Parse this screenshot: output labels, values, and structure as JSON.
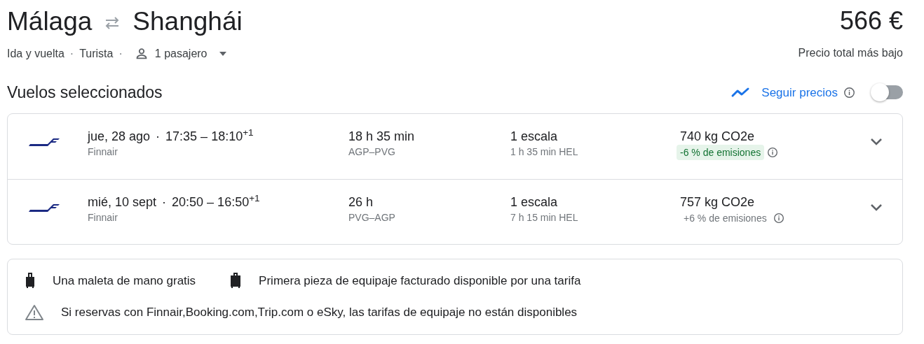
{
  "route": {
    "origin": "Málaga",
    "destination": "Shanghái"
  },
  "trip": {
    "type": "Ida y vuelta",
    "separator_1": "·",
    "cabin": "Turista",
    "separator_2": "·",
    "passengers": "1 pasajero"
  },
  "price": {
    "amount": "566 €",
    "caption": "Precio total más bajo"
  },
  "section_title": "Vuelos seleccionados",
  "track_prices": {
    "label": "Seguir precios",
    "on": false
  },
  "flights": [
    {
      "date": "jue, 28 ago",
      "separator": "·",
      "times": "17:35 – 18:10$^{+1}$",
      "airline": "Finnair",
      "duration": "18 h 35 min",
      "airports": "AGP–PVG",
      "stops": "1 escala",
      "layover": "1 h 35 min HEL",
      "emissions": "740 kg CO2e",
      "emissions_change": "-6 % de emisiones",
      "highlighted": true
    },
    {
      "date": "mié, 10 sept",
      "separator": "·",
      "times": "20:50 – 16:50$^{+1}$",
      "airline": "Finnair",
      "duration": "26 h",
      "airports": "PVG–AGP",
      "stops": "1 escala",
      "layover": "7 h 15 min HEL",
      "emissions": "757 kg CO2e",
      "emissions_change": "+6 % de emisiones",
      "highlighted": false
    }
  ],
  "baggage": [
    {
      "kind": "carry_on",
      "text": "Una maleta de mano gratis"
    },
    {
      "kind": "checked",
      "text": "Primera pieza de equipaje facturado disponible por una tarifa"
    },
    {
      "kind": "warning",
      "text": "Si reservas con Finnair,Booking.com,Trip.com o eSky, las tarifas de equipaje no están disponibles"
    }
  ]
}
